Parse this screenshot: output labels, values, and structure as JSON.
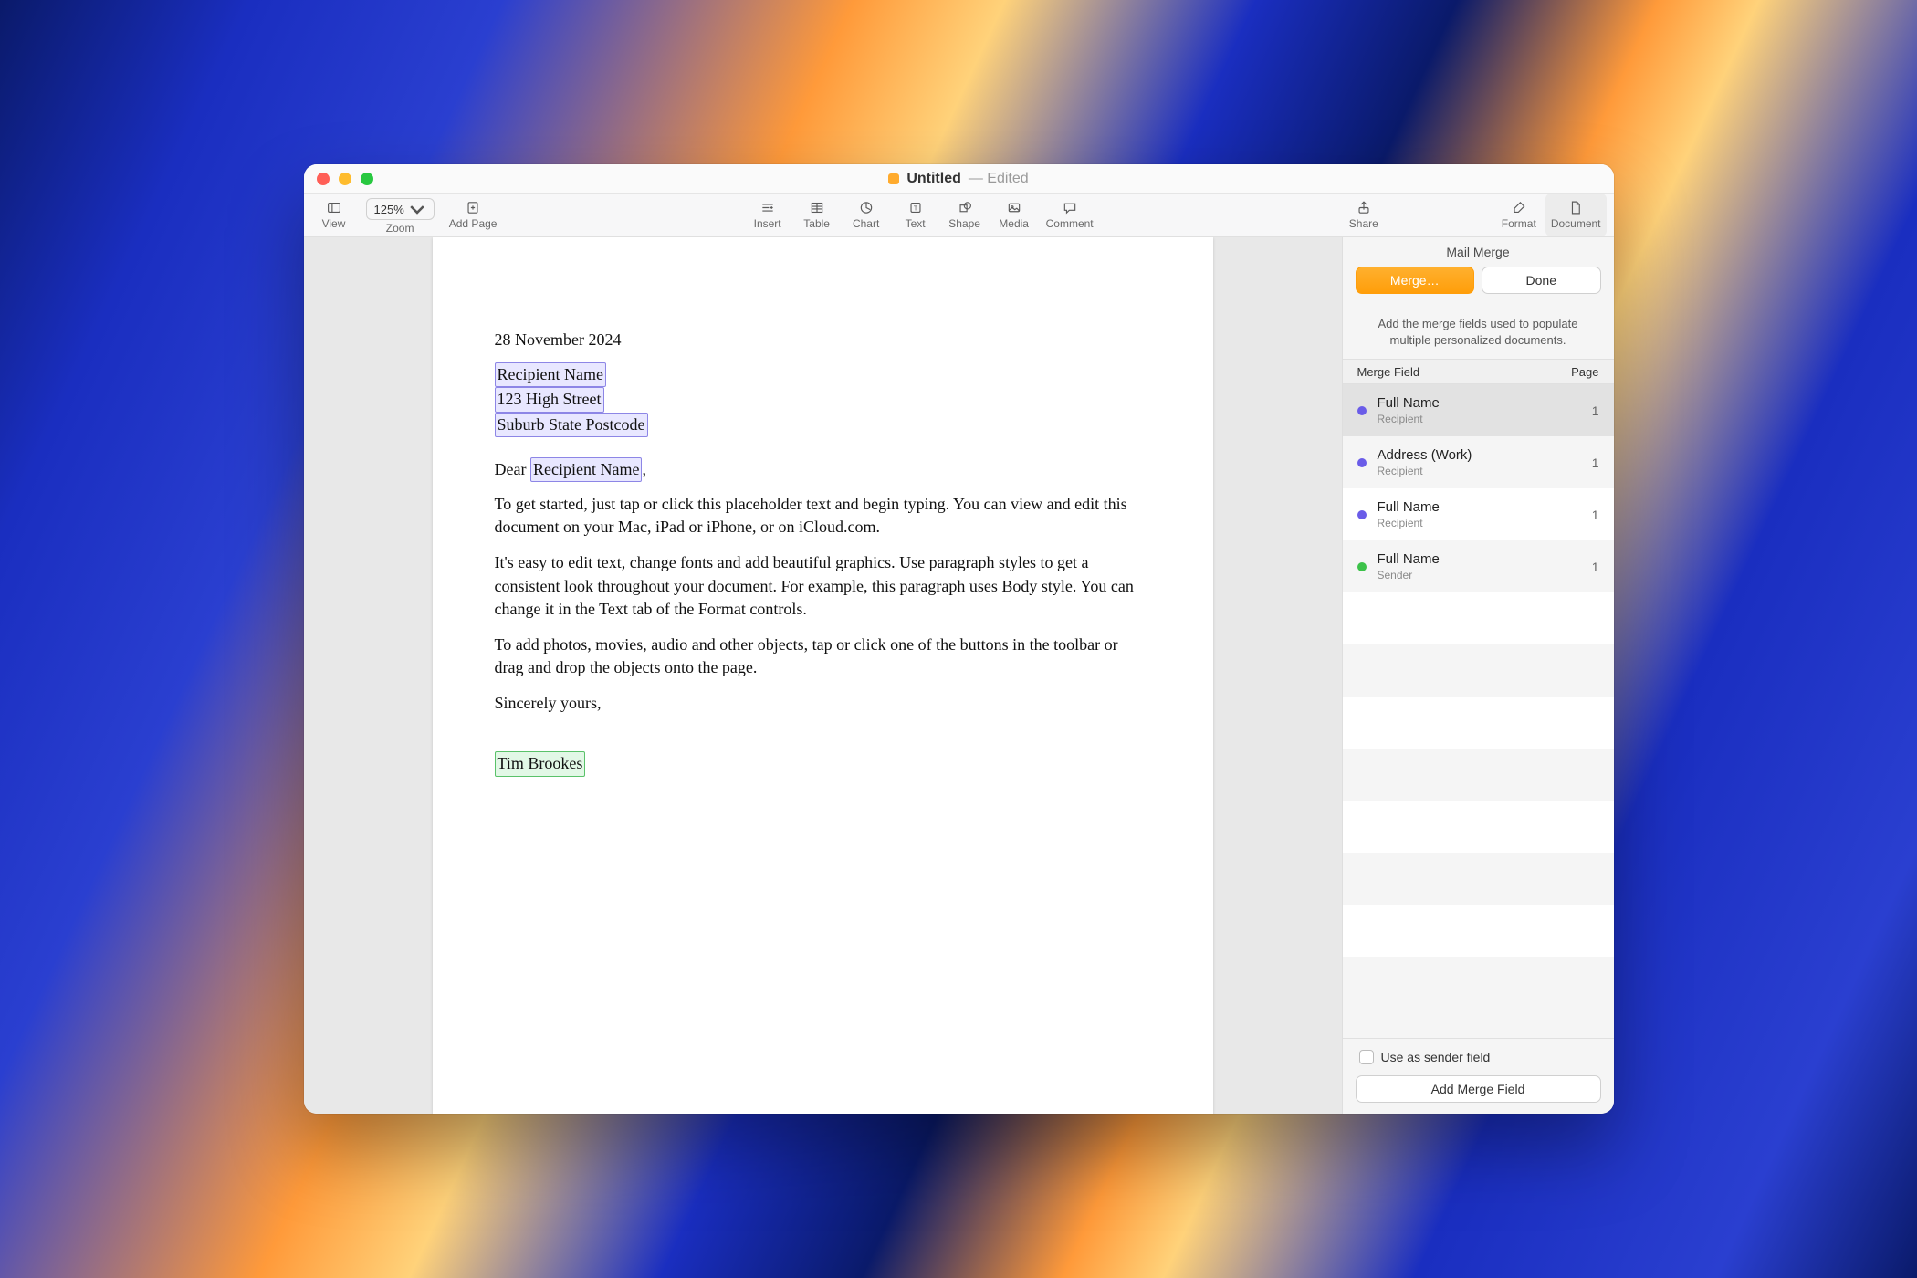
{
  "window": {
    "title": "Untitled",
    "status": "— Edited"
  },
  "toolbar": {
    "view": "View",
    "zoom_value": "125%",
    "zoom": "Zoom",
    "add_page": "Add Page",
    "insert": "Insert",
    "table": "Table",
    "chart": "Chart",
    "text": "Text",
    "shape": "Shape",
    "media": "Media",
    "comment": "Comment",
    "share": "Share",
    "format": "Format",
    "document": "Document"
  },
  "document": {
    "date": "28 November 2024",
    "fields": {
      "recipient_name": "Recipient Name",
      "address_line": "123 High Street",
      "suburb_line": "Suburb State Postcode",
      "salutation_prefix": "Dear ",
      "salutation_name": "Recipient Name",
      "salutation_suffix": ",",
      "sender_name": "Tim Brookes"
    },
    "body1": "To get started, just tap or click this placeholder text and begin typing. You can view and edit this document on your Mac, iPad or iPhone, or on iCloud.com.",
    "body2": "It's easy to edit text, change fonts and add beautiful graphics. Use paragraph styles to get a consistent look throughout your document. For example, this paragraph uses Body style. You can change it in the Text tab of the Format controls.",
    "body3": "To add photos, movies, audio and other objects, tap or click one of the buttons in the toolbar or drag and drop the objects onto the page.",
    "closing": "Sincerely yours,"
  },
  "panel": {
    "title": "Mail Merge",
    "merge_btn": "Merge…",
    "done_btn": "Done",
    "hint": "Add the merge fields used to populate multiple personalized documents.",
    "col_field": "Merge Field",
    "col_page": "Page",
    "rows": [
      {
        "name": "Full Name",
        "sub": "Recipient",
        "page": "1",
        "color": "purple"
      },
      {
        "name": "Address (Work)",
        "sub": "Recipient",
        "page": "1",
        "color": "purple"
      },
      {
        "name": "Full Name",
        "sub": "Recipient",
        "page": "1",
        "color": "purple"
      },
      {
        "name": "Full Name",
        "sub": "Sender",
        "page": "1",
        "color": "green"
      }
    ],
    "use_sender": "Use as sender field",
    "add_field": "Add Merge Field"
  }
}
